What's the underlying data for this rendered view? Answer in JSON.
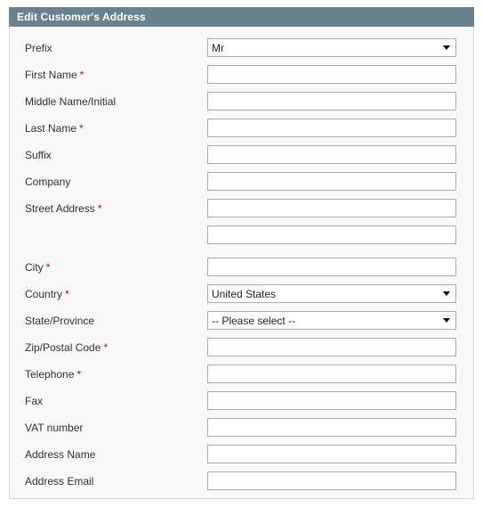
{
  "panel": {
    "title": "Edit Customer's Address",
    "header_color": "#6a828e",
    "body_color": "#f8f8f8",
    "required_marker": "*",
    "required_color": "#d40707"
  },
  "fields": [
    {
      "label": "Prefix",
      "required": false,
      "type": "select",
      "value": "Mr",
      "name": "prefix"
    },
    {
      "label": "First Name",
      "required": true,
      "type": "text",
      "value": "",
      "name": "first-name"
    },
    {
      "label": "Middle Name/Initial",
      "required": false,
      "type": "text",
      "value": "",
      "name": "middle-name"
    },
    {
      "label": "Last Name",
      "required": true,
      "type": "text",
      "value": "",
      "name": "last-name"
    },
    {
      "label": "Suffix",
      "required": false,
      "type": "text",
      "value": "",
      "name": "suffix"
    },
    {
      "label": "Company",
      "required": false,
      "type": "text",
      "value": "",
      "name": "company"
    },
    {
      "label": "Street Address",
      "required": true,
      "type": "text",
      "value": "",
      "name": "street-address-line1"
    },
    {
      "label": "",
      "required": false,
      "type": "text",
      "value": "",
      "name": "street-address-line2"
    },
    {
      "label": "City",
      "required": true,
      "type": "text",
      "value": "",
      "name": "city"
    },
    {
      "label": "Country",
      "required": true,
      "type": "select",
      "value": "United States",
      "name": "country"
    },
    {
      "label": "State/Province",
      "required": false,
      "type": "select",
      "value": "-- Please select --",
      "name": "state-province"
    },
    {
      "label": "Zip/Postal Code",
      "required": true,
      "type": "text",
      "value": "",
      "name": "zip-postal-code"
    },
    {
      "label": "Telephone",
      "required": true,
      "type": "text",
      "value": "",
      "name": "telephone"
    },
    {
      "label": "Fax",
      "required": false,
      "type": "text",
      "value": "",
      "name": "fax"
    },
    {
      "label": "VAT number",
      "required": false,
      "type": "text",
      "value": "",
      "name": "vat-number"
    },
    {
      "label": "Address Name",
      "required": false,
      "type": "text",
      "value": "",
      "name": "address-name"
    },
    {
      "label": "Address Email",
      "required": false,
      "type": "text",
      "value": "",
      "name": "address-email"
    }
  ]
}
